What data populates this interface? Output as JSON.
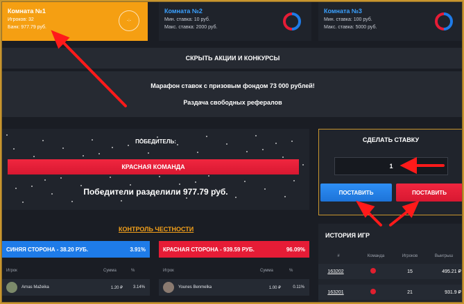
{
  "rooms": [
    {
      "name": "Комната №1",
      "line1": "Игроков: 32",
      "line2": "Банк: 977.79 руб.",
      "dial": "-:-"
    },
    {
      "name": "Комната №2",
      "line1": "Мин. ставка: 10 руб.",
      "line2": "Макс. ставка: 2000 руб."
    },
    {
      "name": "Комната №3",
      "line1": "Мин. ставка: 100 руб.",
      "line2": "Макс. ставка: 5000 руб."
    }
  ],
  "hide_promos": "СКРЫТЬ АКЦИИ И КОНКУРСЫ",
  "promos": [
    "Марафон ставок с призовым фондом 73 000 рублей!",
    "Раздача свободных рефералов"
  ],
  "winner": {
    "title": "ПОБЕДИТЕЛЬ:",
    "team": "КРАСНАЯ КОМАНДА",
    "text": "Победители разделили 977.79 руб."
  },
  "bet": {
    "title": "СДЕЛАТЬ СТАВКУ",
    "value": "1",
    "blue_label": "ПОСТАВИТЬ",
    "red_label": "ПОСТАВИТЬ"
  },
  "honesty": "КОНТРОЛЬ ЧЕСТНОСТИ",
  "blue_side": {
    "label": "СИНЯЯ СТОРОНА - 38.20 РУБ.",
    "pct": "3.91%",
    "headers": [
      "Игрок",
      "Сумма",
      "%"
    ],
    "rows": [
      {
        "player": "Arnas Mažeika",
        "sum": "1.20 ₽",
        "pct": "3.14%"
      }
    ]
  },
  "red_side": {
    "label": "КРАСНАЯ СТОРОНА - 939.59 РУБ.",
    "pct": "96.09%",
    "headers": [
      "Игрок",
      "Сумма",
      "%"
    ],
    "rows": [
      {
        "player": "Younes Benmelka",
        "sum": "1.00 ₽",
        "pct": "0.11%"
      }
    ]
  },
  "history": {
    "title": "ИСТОРИЯ ИГР",
    "headers": [
      "#",
      "Команда",
      "Игроков",
      "Выигрыш"
    ],
    "rows": [
      {
        "id": "163202",
        "players": "15",
        "win": "495.21 ₽"
      },
      {
        "id": "163201",
        "players": "21",
        "win": "931.9 ₽"
      }
    ]
  },
  "colors": {
    "orange": "#f59f12",
    "blue": "#1e7be8",
    "red": "#e61c36",
    "arrow": "#ff1a1a"
  }
}
